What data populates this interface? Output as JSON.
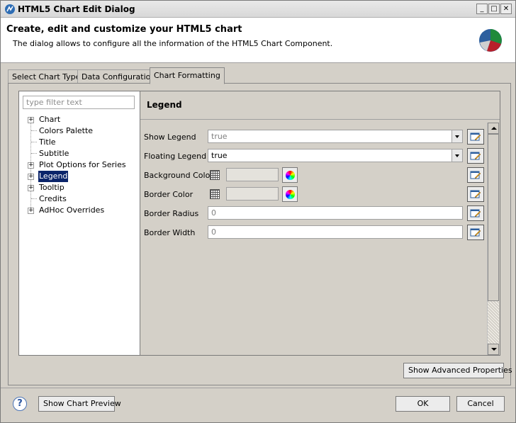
{
  "window": {
    "title": "HTML5 Chart Edit Dialog"
  },
  "header": {
    "title": "Create, edit and customize your HTML5 chart",
    "description": "The dialog allows to configure all the information of the HTML5 Chart Component."
  },
  "tabs": [
    {
      "label": "Select Chart Type",
      "active": false
    },
    {
      "label": "Data Configuration",
      "active": false
    },
    {
      "label": "Chart Formatting",
      "active": true
    }
  ],
  "filter": {
    "placeholder": "type filter text",
    "value": ""
  },
  "tree": [
    {
      "label": "Chart",
      "expandable": true,
      "selected": false
    },
    {
      "label": "Colors Palette",
      "expandable": false,
      "selected": false
    },
    {
      "label": "Title",
      "expandable": false,
      "selected": false
    },
    {
      "label": "Subtitle",
      "expandable": false,
      "selected": false
    },
    {
      "label": "Plot Options for Series",
      "expandable": true,
      "selected": false
    },
    {
      "label": "Legend",
      "expandable": true,
      "selected": true
    },
    {
      "label": "Tooltip",
      "expandable": true,
      "selected": false
    },
    {
      "label": "Credits",
      "expandable": false,
      "selected": false
    },
    {
      "label": "AdHoc Overrides",
      "expandable": true,
      "selected": false
    }
  ],
  "section": {
    "title": "Legend"
  },
  "properties": {
    "show_legend": {
      "label": "Show Legend",
      "value": "true",
      "enabled": false
    },
    "floating_legend": {
      "label": "Floating Legend",
      "value": "true",
      "enabled": true
    },
    "background_color": {
      "label": "Background Color",
      "value": ""
    },
    "border_color": {
      "label": "Border Color",
      "value": ""
    },
    "border_radius": {
      "label": "Border Radius",
      "value": "0"
    },
    "border_width": {
      "label": "Border Width",
      "value": "0"
    }
  },
  "buttons": {
    "advanced": "Show Advanced Properties",
    "preview": "Show Chart Preview",
    "ok": "OK",
    "cancel": "Cancel",
    "help": "?"
  },
  "icons": {
    "app": "chart-edit-icon",
    "pie": "pie-chart-icon",
    "edit": "edit-expression-icon",
    "color_picker": "color-wheel-icon",
    "color_grid": "color-grid-icon"
  },
  "colors": {
    "selection": "#0a246a",
    "dialog_bg": "#d4d0c8"
  }
}
